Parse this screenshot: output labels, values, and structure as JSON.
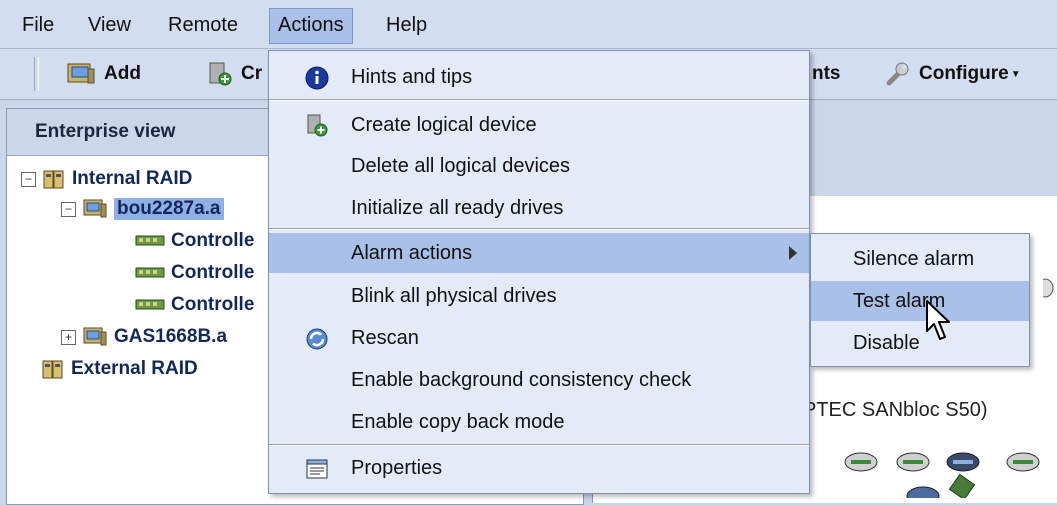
{
  "menubar": {
    "file": "File",
    "view": "View",
    "remote": "Remote",
    "actions": "Actions",
    "help": "Help"
  },
  "toolbar": {
    "add": "Add",
    "create_partial": "Cr",
    "events_partial": "nts",
    "configure": "Configure"
  },
  "left_panel": {
    "title": "Enterprise view",
    "tree": {
      "internal_raid": "Internal RAID",
      "host1": "bou2287a.a",
      "controller1": "Controlle",
      "controller2": "Controlle",
      "controller3": "Controlle",
      "host2": "GAS1668B.a",
      "external_raid": "External RAID"
    }
  },
  "right_panel": {
    "enclosure_label": "PTEC SANbloc S50)"
  },
  "actions_menu": {
    "items": [
      {
        "label": "Hints and tips",
        "icon": "info-icon"
      },
      {
        "label": "Create logical device",
        "icon": "create-device-icon"
      },
      {
        "label": "Delete all logical devices",
        "icon": ""
      },
      {
        "label": "Initialize all ready drives",
        "icon": ""
      },
      {
        "label": "Alarm actions",
        "icon": "",
        "submenu": true,
        "highlighted": true
      },
      {
        "label": "Blink all physical drives",
        "icon": ""
      },
      {
        "label": "Rescan",
        "icon": "rescan-icon"
      },
      {
        "label": "Enable background consistency check",
        "icon": ""
      },
      {
        "label": "Enable copy back mode",
        "icon": ""
      },
      {
        "label": "Properties",
        "icon": "properties-icon"
      }
    ]
  },
  "alarm_submenu": {
    "items": [
      {
        "label": "Silence alarm"
      },
      {
        "label": "Test alarm",
        "highlighted": true
      },
      {
        "label": "Disable"
      }
    ]
  },
  "colors": {
    "menu_highlight": "#a9c0e8",
    "menu_bg": "#e4ebf8",
    "chrome_bg": "#d3ddf0",
    "tree_text": "#13285a"
  }
}
